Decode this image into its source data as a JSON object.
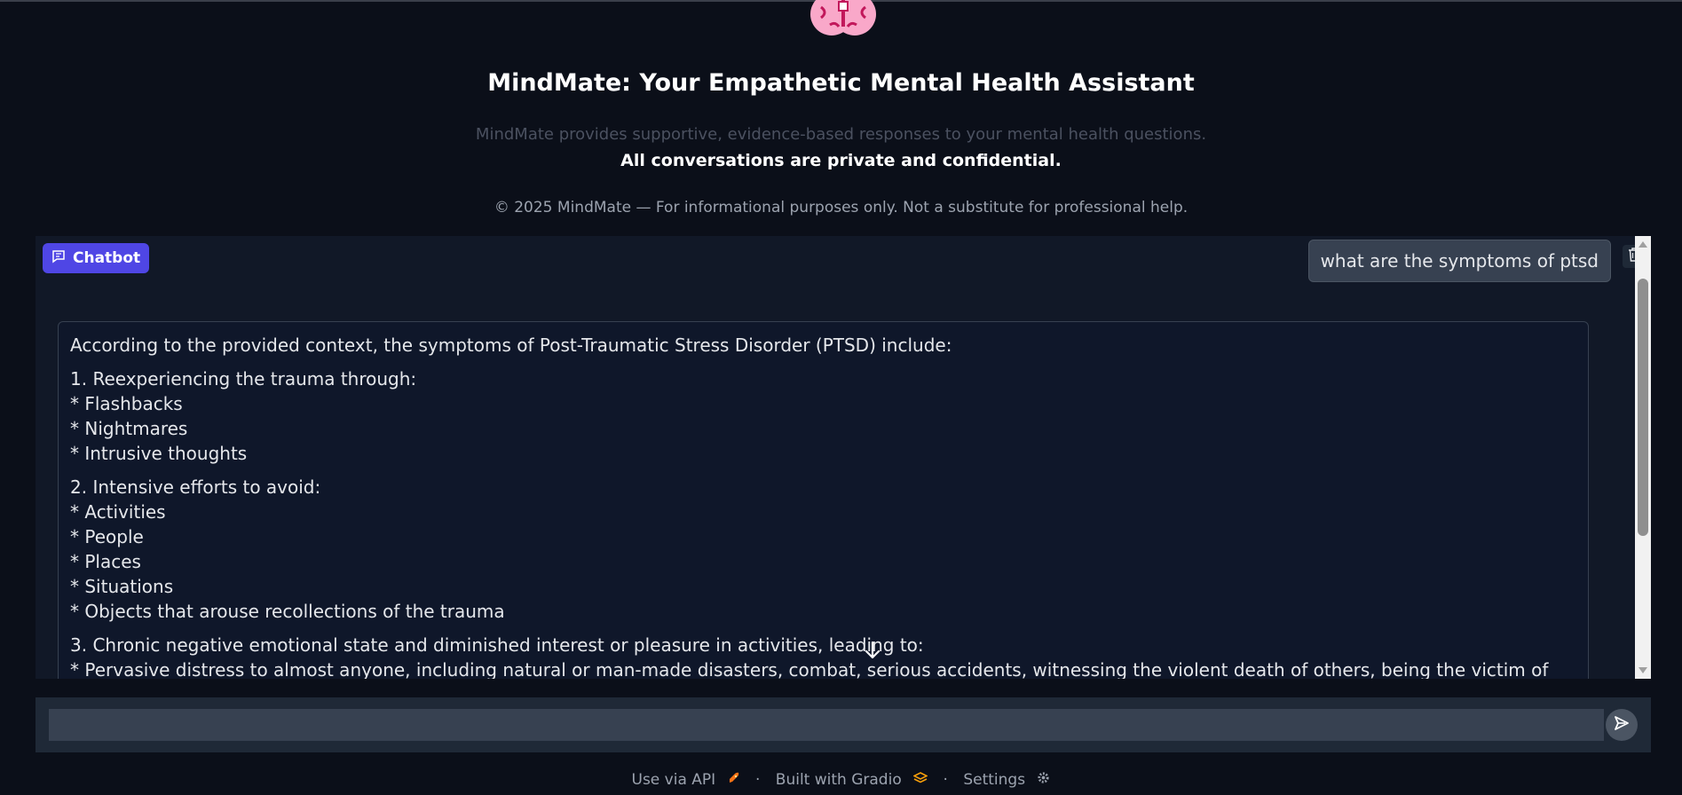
{
  "header": {
    "title": "MindMate: Your Empathetic Mental Health Assistant",
    "subtitle": "MindMate provides supportive, evidence-based responses to your mental health questions.",
    "privacy": "All conversations are private and confidential.",
    "copyright": "© 2025 MindMate — For informational purposes only. Not a substitute for professional help."
  },
  "chatbot": {
    "label": "Chatbot",
    "user_message": "what are the symptoms of ptsd",
    "bot_response": {
      "intro": "According to the provided context, the symptoms of Post-Traumatic Stress Disorder (PTSD) include:",
      "s1_title": "1. Reexperiencing the trauma through:",
      "s1_items": [
        "* Flashbacks",
        "* Nightmares",
        "* Intrusive thoughts"
      ],
      "s2_title": "2. Intensive efforts to avoid:",
      "s2_items": [
        "* Activities",
        "* People",
        "* Places",
        "* Situations",
        "* Objects that arouse recollections of the trauma"
      ],
      "s3_title": "3. Chronic negative emotional state and diminished interest or pleasure in activities, leading to:",
      "s3_items": [
        "* Pervasive distress to almost anyone, including natural or man-made disasters, combat, serious accidents, witnessing the violent death of others, being the victim of"
      ]
    }
  },
  "input": {
    "placeholder": "",
    "value": ""
  },
  "footer": {
    "api": "Use via API",
    "gradio": "Built with Gradio",
    "settings": "Settings",
    "separator": "·"
  },
  "colors": {
    "background": "#0b0f19",
    "accent": "#4f46e5",
    "logo_pink": "#f9a8c9"
  },
  "icons": [
    "brain-logo-icon",
    "chat-icon",
    "trash-icon",
    "arrow-down-icon",
    "send-icon",
    "rocket-icon",
    "gradio-icon",
    "gear-icon"
  ]
}
